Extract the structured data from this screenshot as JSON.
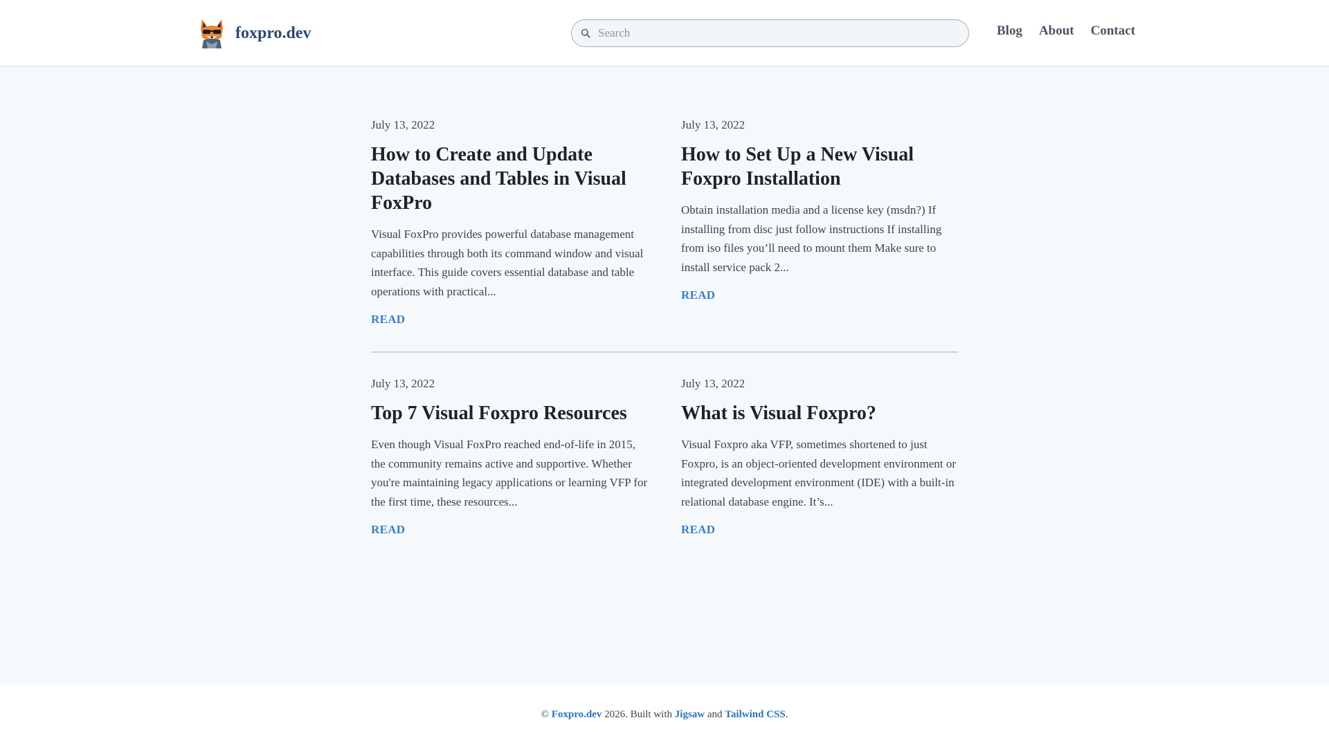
{
  "header": {
    "brand_name": "foxpro.dev",
    "search_placeholder": "Search",
    "nav": [
      "Blog",
      "About",
      "Contact"
    ]
  },
  "posts": [
    {
      "date": "July 13, 2022",
      "title": "How to Create and Update Databases and Tables in Visual FoxPro",
      "excerpt": "Visual FoxPro provides powerful database management capabilities through both its command window and visual interface. This guide covers essential database and table operations with practical...",
      "read_label": "READ"
    },
    {
      "date": "July 13, 2022",
      "title": "How to Set Up a New Visual Foxpro Installation",
      "excerpt": "Obtain installation media and a license key (msdn?) If installing from disc just follow instructions If installing from iso files you’ll need to mount them Make sure to install service pack 2...",
      "read_label": "READ"
    },
    {
      "date": "July 13, 2022",
      "title": "Top 7 Visual Foxpro Resources",
      "excerpt": "Even though Visual FoxPro reached end-of-life in 2015, the community remains active and supportive. Whether you're maintaining legacy applications or learning VFP for the first time, these resources...",
      "read_label": "READ"
    },
    {
      "date": "July 13, 2022",
      "title": "What is Visual Foxpro?",
      "excerpt": "Visual Foxpro aka VFP, sometimes shortened to just Foxpro, is an object-oriented development environment or integrated development environment (IDE) with a built-in relational database engine. It’s...",
      "read_label": "READ"
    }
  ],
  "footer": {
    "copyright": "©",
    "site_link": "Foxpro.dev",
    "year_text": "2026.  Built with",
    "jigsaw_link": "Jigsaw",
    "and_text": "and",
    "tailwind_link": "Tailwind CSS",
    "period": "."
  },
  "colors": {
    "background": "#f6f9fc",
    "brand": "#2b4a6e",
    "link": "#3a7ec2",
    "divider": "#b6dbe9"
  },
  "icons": [
    "fox-logo-icon",
    "search-icon"
  ]
}
